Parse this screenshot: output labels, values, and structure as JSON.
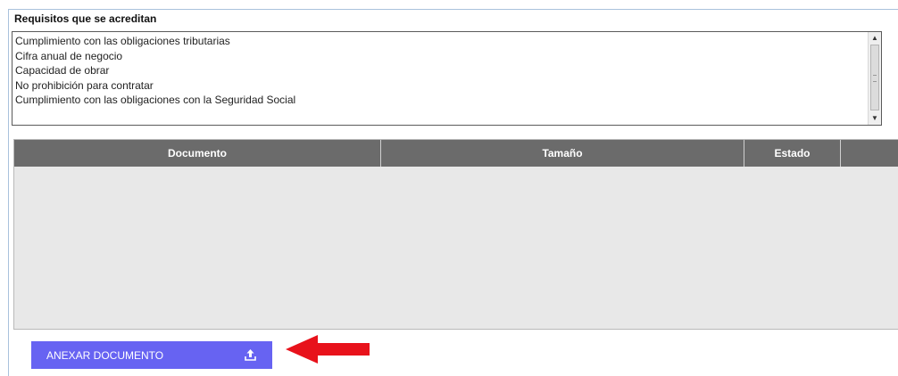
{
  "requirements": {
    "label": "Requisitos que se acreditan",
    "items": [
      "Cumplimiento con las obligaciones tributarias",
      "Cifra anual de negocio",
      "Capacidad de obrar",
      "No prohibición para contratar",
      "Cumplimiento con las obligaciones con la Seguridad Social"
    ]
  },
  "documents_table": {
    "columns": [
      "Documento",
      "Tamaño",
      "Estado",
      ""
    ],
    "rows": []
  },
  "attach_button": {
    "label": "ANEXAR DOCUMENTO",
    "icon": "upload-icon"
  },
  "annotation": {
    "icon": "red-arrow-icon",
    "color": "#e8121b"
  },
  "colors": {
    "button": "#6763f2",
    "table_header": "#6b6b6b",
    "table_body": "#e8e8e8"
  }
}
